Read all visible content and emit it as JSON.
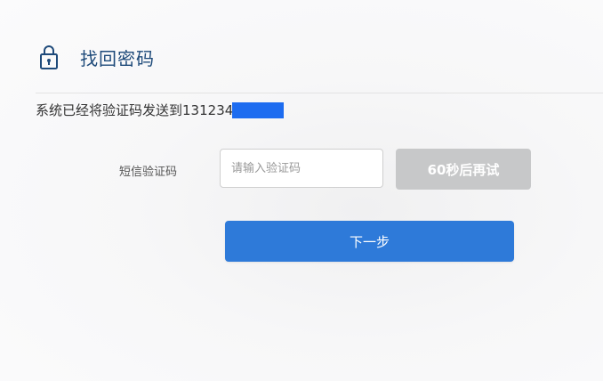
{
  "header": {
    "icon": "lock-icon",
    "title": "找回密码"
  },
  "notice": {
    "text": "系统已经将验证码发送到",
    "phone_visible": "131234"
  },
  "form": {
    "code_label": "短信验证码",
    "code_placeholder": "请输入验证码",
    "resend_label": "60秒后再试",
    "next_label": "下一步"
  },
  "colors": {
    "title": "#1e4a7a",
    "primary_button": "#2e7ad9",
    "disabled_button": "#c7c8c9",
    "mask": "#1d6cf0"
  }
}
